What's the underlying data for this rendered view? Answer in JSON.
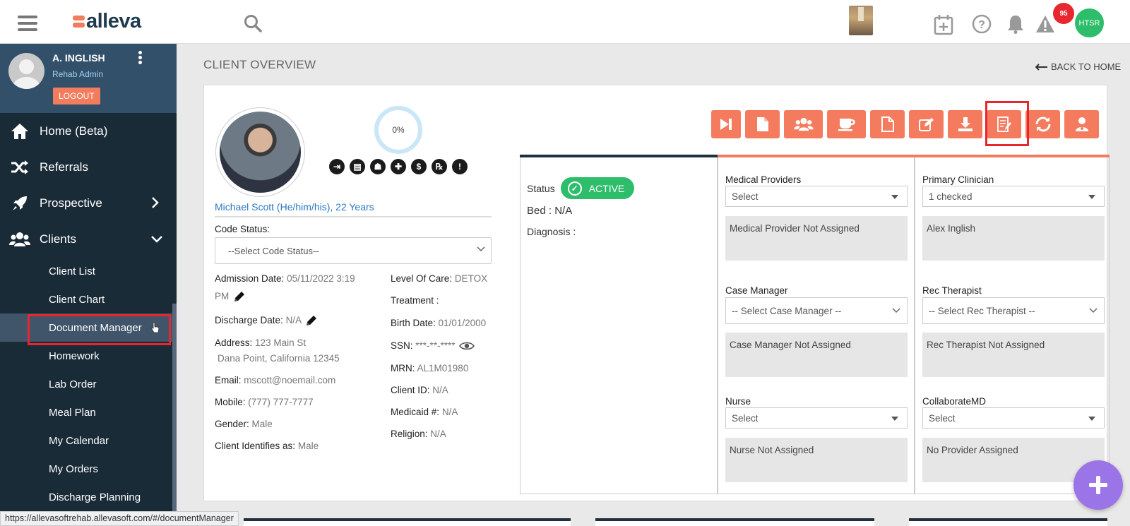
{
  "header": {
    "logo_text": "alleva",
    "notification_count": "95",
    "user_initials": "HTSR"
  },
  "sidebar": {
    "user_name": "A. INGLISH",
    "user_role": "Rehab Admin",
    "logout_label": "LOGOUT",
    "main_items": [
      {
        "label": "Home (Beta)",
        "icon": "home-icon"
      },
      {
        "label": "Referrals",
        "icon": "shuffle-icon"
      },
      {
        "label": "Prospective",
        "icon": "rocket-icon"
      },
      {
        "label": "Clients",
        "icon": "users-icon"
      }
    ],
    "sub_items": [
      {
        "label": "Client List"
      },
      {
        "label": "Client Chart"
      },
      {
        "label": "Document Manager"
      },
      {
        "label": "Homework"
      },
      {
        "label": "Lab Order"
      },
      {
        "label": "Meal Plan"
      },
      {
        "label": "My Calendar"
      },
      {
        "label": "My Orders"
      },
      {
        "label": "Discharge Planning"
      }
    ]
  },
  "page": {
    "title": "CLIENT OVERVIEW",
    "back_label": "BACK TO HOME"
  },
  "client": {
    "progress": "0%",
    "name": "Michael Scott (He/him/his),  22 Years",
    "code_status_label": "Code Status:",
    "code_status_placeholder": "--Select Code Status--",
    "admission_label": "Admission Date:",
    "admission_value": "05/11/2022 3:19",
    "admission_value2": "PM",
    "discharge_label": "Discharge Date:",
    "discharge_value": "N/A",
    "address_label": "Address:",
    "address_line1": "123 Main St",
    "address_line2": "Dana Point,  California  12345",
    "email_label": "Email:",
    "email_value": "mscott@noemail.com",
    "mobile_label": "Mobile:",
    "mobile_value": "(777) 777-7777",
    "gender_label": "Gender:",
    "gender_value": "Male",
    "identifies_label": "Client Identifies as:",
    "identifies_value": "Male",
    "loc_label": "Level Of Care:",
    "loc_value": "DETOX",
    "treatment_label": "Treatment :",
    "birth_label": "Birth Date:",
    "birth_value": "01/01/2000",
    "ssn_label": "SSN:",
    "ssn_value": "***-**-****",
    "mrn_label": "MRN:",
    "mrn_value": "AL1M01980",
    "clientid_label": "Client ID:",
    "clientid_value": "N/A",
    "medicaid_label": "Medicaid #:",
    "medicaid_value": "N/A",
    "religion_label": "Religion:",
    "religion_value": "N/A"
  },
  "status": {
    "label": "Status",
    "value": "ACTIVE",
    "bed": "Bed : N/A",
    "diagnosis": "Diagnosis :"
  },
  "providers": {
    "medical_label": "Medical Providers",
    "medical_select": "Select",
    "medical_box": "Medical Provider Not Assigned",
    "clinician_label": "Primary Clinician",
    "clinician_select": "1 checked",
    "clinician_box": "Alex Inglish",
    "case_label": "Case Manager",
    "case_select": "-- Select Case Manager --",
    "case_box": "Case Manager Not Assigned",
    "rec_label": "Rec Therapist",
    "rec_select": "-- Select Rec Therapist --",
    "rec_box": "Rec Therapist Not Assigned",
    "nurse_label": "Nurse",
    "nurse_select": "Select",
    "nurse_box": "Nurse Not Assigned",
    "cmd_label": "CollaborateMD",
    "cmd_select": "Select",
    "cmd_box": "No Provider Assigned"
  },
  "status_url": "https://allevasoftrehab.allevasoft.com/#/documentManager",
  "colors": {
    "accent": "#f47b5e",
    "sidebar_bg": "#1a2b38",
    "active_green": "#2dbd6b",
    "highlight_red": "#e8262d",
    "fab": "#9b74e8"
  }
}
